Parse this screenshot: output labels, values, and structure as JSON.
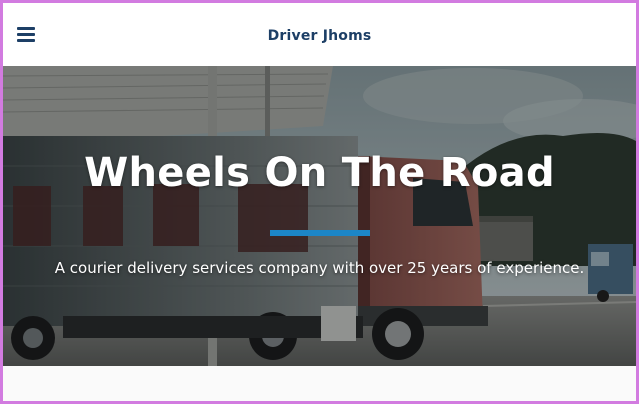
{
  "header": {
    "brand": "Driver Jhoms",
    "menu_icon": "hamburger-menu-icon"
  },
  "hero": {
    "title": "Wheels On The Road",
    "subtitle": "A courier delivery services company with over 25 years of experience.",
    "accent_color": "#1c86c7",
    "background_image": "red-cargo-truck-photo"
  },
  "colors": {
    "brand_text": "#1d3f66",
    "frame_border": "#d27be0"
  }
}
